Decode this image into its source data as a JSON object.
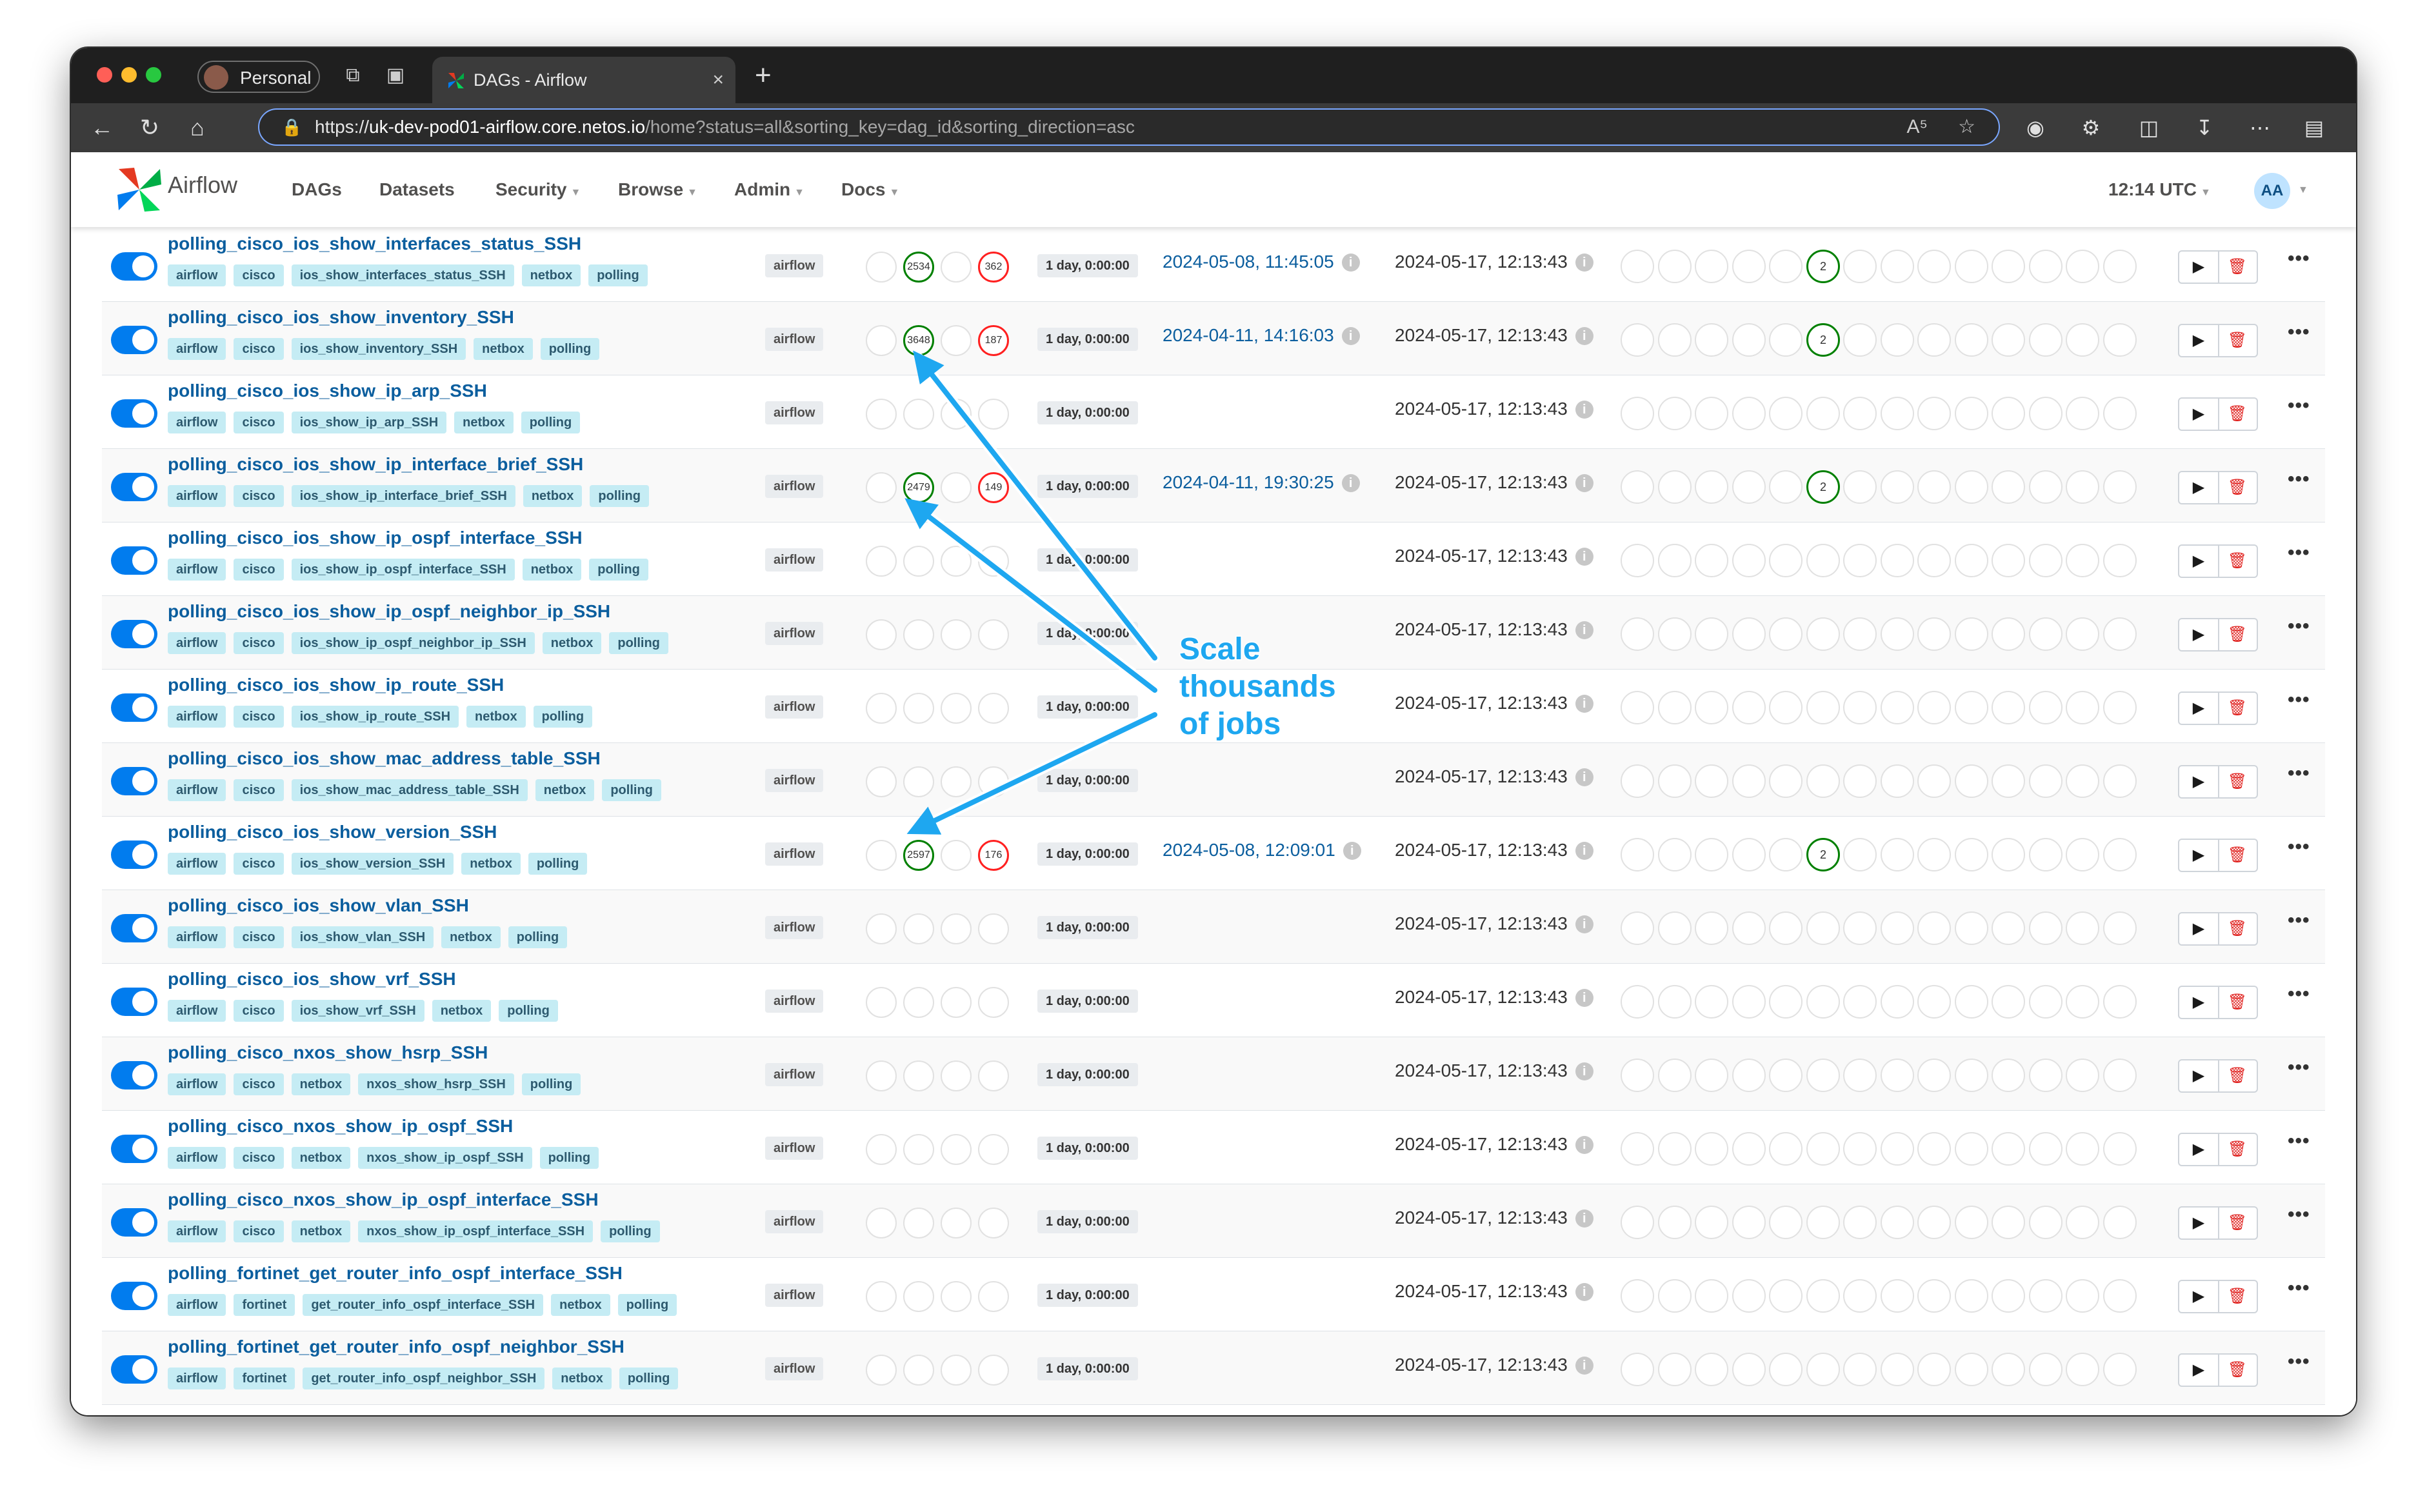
{
  "browser": {
    "profile_label": "Personal",
    "tab_title": "DAGs - Airflow",
    "url_scheme": "https://",
    "url_host": "uk-dev-pod01-airflow.core.netos.io",
    "url_rest": "/home?status=all&sorting_key=dag_id&sorting_direction=asc"
  },
  "navbar": {
    "logo_text": "Airflow",
    "items": [
      "DAGs",
      "Datasets",
      "Security",
      "Browse",
      "Admin",
      "Docs"
    ],
    "time": "12:14 UTC",
    "user_initials": "AA"
  },
  "annotation": {
    "line1": "Scale",
    "line2": "thousands",
    "line3": "of jobs",
    "color": "#1ea7f0"
  },
  "rows": [
    {
      "name": "polling_cisco_ios_show_interfaces_status_SSH",
      "tags": [
        "airflow",
        "cisco",
        "ios_show_interfaces_status_SSH",
        "netbox",
        "polling"
      ],
      "owner": "airflow",
      "runs": [
        "",
        "2534",
        "",
        "362"
      ],
      "schedule": "1 day, 0:00:00",
      "last_run": "2024-05-08, 11:45:05",
      "next_run": "2024-05-17, 12:13:43",
      "tasks": {
        "5": "2"
      }
    },
    {
      "name": "polling_cisco_ios_show_inventory_SSH",
      "tags": [
        "airflow",
        "cisco",
        "ios_show_inventory_SSH",
        "netbox",
        "polling"
      ],
      "owner": "airflow",
      "runs": [
        "",
        "3648",
        "",
        "187"
      ],
      "schedule": "1 day, 0:00:00",
      "last_run": "2024-04-11, 14:16:03",
      "next_run": "2024-05-17, 12:13:43",
      "tasks": {
        "5": "2"
      }
    },
    {
      "name": "polling_cisco_ios_show_ip_arp_SSH",
      "tags": [
        "airflow",
        "cisco",
        "ios_show_ip_arp_SSH",
        "netbox",
        "polling"
      ],
      "owner": "airflow",
      "runs": [
        "",
        "",
        "",
        ""
      ],
      "schedule": "1 day, 0:00:00",
      "last_run": "",
      "next_run": "2024-05-17, 12:13:43",
      "tasks": {}
    },
    {
      "name": "polling_cisco_ios_show_ip_interface_brief_SSH",
      "tags": [
        "airflow",
        "cisco",
        "ios_show_ip_interface_brief_SSH",
        "netbox",
        "polling"
      ],
      "owner": "airflow",
      "runs": [
        "",
        "2479",
        "",
        "149"
      ],
      "schedule": "1 day, 0:00:00",
      "last_run": "2024-04-11, 19:30:25",
      "next_run": "2024-05-17, 12:13:43",
      "tasks": {
        "5": "2"
      }
    },
    {
      "name": "polling_cisco_ios_show_ip_ospf_interface_SSH",
      "tags": [
        "airflow",
        "cisco",
        "ios_show_ip_ospf_interface_SSH",
        "netbox",
        "polling"
      ],
      "owner": "airflow",
      "runs": [
        "",
        "",
        "",
        ""
      ],
      "schedule": "1 day, 0:00:00",
      "last_run": "",
      "next_run": "2024-05-17, 12:13:43",
      "tasks": {}
    },
    {
      "name": "polling_cisco_ios_show_ip_ospf_neighbor_ip_SSH",
      "tags": [
        "airflow",
        "cisco",
        "ios_show_ip_ospf_neighbor_ip_SSH",
        "netbox",
        "polling"
      ],
      "owner": "airflow",
      "runs": [
        "",
        "",
        "",
        ""
      ],
      "schedule": "1 day, 0:00:00",
      "last_run": "",
      "next_run": "2024-05-17, 12:13:43",
      "tasks": {}
    },
    {
      "name": "polling_cisco_ios_show_ip_route_SSH",
      "tags": [
        "airflow",
        "cisco",
        "ios_show_ip_route_SSH",
        "netbox",
        "polling"
      ],
      "owner": "airflow",
      "runs": [
        "",
        "",
        "",
        ""
      ],
      "schedule": "1 day, 0:00:00",
      "last_run": "",
      "next_run": "2024-05-17, 12:13:43",
      "tasks": {}
    },
    {
      "name": "polling_cisco_ios_show_mac_address_table_SSH",
      "tags": [
        "airflow",
        "cisco",
        "ios_show_mac_address_table_SSH",
        "netbox",
        "polling"
      ],
      "owner": "airflow",
      "runs": [
        "",
        "",
        "",
        ""
      ],
      "schedule": "1 day, 0:00:00",
      "last_run": "",
      "next_run": "2024-05-17, 12:13:43",
      "tasks": {}
    },
    {
      "name": "polling_cisco_ios_show_version_SSH",
      "tags": [
        "airflow",
        "cisco",
        "ios_show_version_SSH",
        "netbox",
        "polling"
      ],
      "owner": "airflow",
      "runs": [
        "",
        "2597",
        "",
        "176"
      ],
      "schedule": "1 day, 0:00:00",
      "last_run": "2024-05-08, 12:09:01",
      "next_run": "2024-05-17, 12:13:43",
      "tasks": {
        "5": "2"
      }
    },
    {
      "name": "polling_cisco_ios_show_vlan_SSH",
      "tags": [
        "airflow",
        "cisco",
        "ios_show_vlan_SSH",
        "netbox",
        "polling"
      ],
      "owner": "airflow",
      "runs": [
        "",
        "",
        "",
        ""
      ],
      "schedule": "1 day, 0:00:00",
      "last_run": "",
      "next_run": "2024-05-17, 12:13:43",
      "tasks": {}
    },
    {
      "name": "polling_cisco_ios_show_vrf_SSH",
      "tags": [
        "airflow",
        "cisco",
        "ios_show_vrf_SSH",
        "netbox",
        "polling"
      ],
      "owner": "airflow",
      "runs": [
        "",
        "",
        "",
        ""
      ],
      "schedule": "1 day, 0:00:00",
      "last_run": "",
      "next_run": "2024-05-17, 12:13:43",
      "tasks": {}
    },
    {
      "name": "polling_cisco_nxos_show_hsrp_SSH",
      "tags": [
        "airflow",
        "cisco",
        "netbox",
        "nxos_show_hsrp_SSH",
        "polling"
      ],
      "owner": "airflow",
      "runs": [
        "",
        "",
        "",
        ""
      ],
      "schedule": "1 day, 0:00:00",
      "last_run": "",
      "next_run": "2024-05-17, 12:13:43",
      "tasks": {}
    },
    {
      "name": "polling_cisco_nxos_show_ip_ospf_SSH",
      "tags": [
        "airflow",
        "cisco",
        "netbox",
        "nxos_show_ip_ospf_SSH",
        "polling"
      ],
      "owner": "airflow",
      "runs": [
        "",
        "",
        "",
        ""
      ],
      "schedule": "1 day, 0:00:00",
      "last_run": "",
      "next_run": "2024-05-17, 12:13:43",
      "tasks": {}
    },
    {
      "name": "polling_cisco_nxos_show_ip_ospf_interface_SSH",
      "tags": [
        "airflow",
        "cisco",
        "netbox",
        "nxos_show_ip_ospf_interface_SSH",
        "polling"
      ],
      "owner": "airflow",
      "runs": [
        "",
        "",
        "",
        ""
      ],
      "schedule": "1 day, 0:00:00",
      "last_run": "",
      "next_run": "2024-05-17, 12:13:43",
      "tasks": {}
    },
    {
      "name": "polling_fortinet_get_router_info_ospf_interface_SSH",
      "tags": [
        "airflow",
        "fortinet",
        "get_router_info_ospf_interface_SSH",
        "netbox",
        "polling"
      ],
      "owner": "airflow",
      "runs": [
        "",
        "",
        "",
        ""
      ],
      "schedule": "1 day, 0:00:00",
      "last_run": "",
      "next_run": "2024-05-17, 12:13:43",
      "tasks": {}
    },
    {
      "name": "polling_fortinet_get_router_info_ospf_neighbor_SSH",
      "tags": [
        "airflow",
        "fortinet",
        "get_router_info_ospf_neighbor_SSH",
        "netbox",
        "polling"
      ],
      "owner": "airflow",
      "runs": [
        "",
        "",
        "",
        ""
      ],
      "schedule": "1 day, 0:00:00",
      "last_run": "",
      "next_run": "2024-05-17, 12:13:43",
      "tasks": {}
    }
  ],
  "colors": {
    "success": "#008000",
    "failed": "#ff2020",
    "link": "#0b5e9e",
    "toggle_on": "#017cee"
  }
}
